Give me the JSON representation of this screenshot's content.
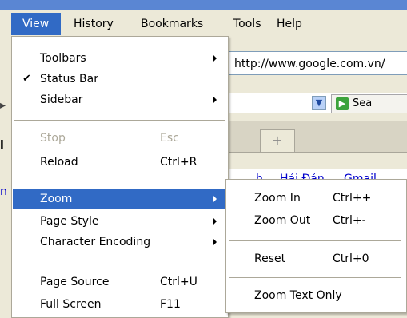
{
  "menubar": {
    "items": [
      {
        "label": "View"
      },
      {
        "label": "History"
      },
      {
        "label": "Bookmarks"
      },
      {
        "label": "Tools"
      },
      {
        "label": "Help"
      }
    ]
  },
  "browser": {
    "url": "http://www.google.com.vn/",
    "search_button": "Sea",
    "links": [
      "h",
      "Hải Đản",
      "Gmail"
    ]
  },
  "view_menu": {
    "items": [
      {
        "label": "Toolbars",
        "shortcut": ""
      },
      {
        "label": "Status Bar",
        "shortcut": ""
      },
      {
        "label": "Sidebar",
        "shortcut": ""
      },
      {
        "label": "Stop",
        "shortcut": "Esc"
      },
      {
        "label": "Reload",
        "shortcut": "Ctrl+R"
      },
      {
        "label": "Zoom",
        "shortcut": ""
      },
      {
        "label": "Page Style",
        "shortcut": ""
      },
      {
        "label": "Character Encoding",
        "shortcut": ""
      },
      {
        "label": "Page Source",
        "shortcut": "Ctrl+U"
      },
      {
        "label": "Full Screen",
        "shortcut": "F11"
      }
    ]
  },
  "zoom_menu": {
    "items": [
      {
        "label": "Zoom In",
        "shortcut": "Ctrl++"
      },
      {
        "label": "Zoom Out",
        "shortcut": "Ctrl+-"
      },
      {
        "label": "Reset",
        "shortcut": "Ctrl+0"
      },
      {
        "label": "Zoom Text Only",
        "shortcut": ""
      }
    ]
  }
}
